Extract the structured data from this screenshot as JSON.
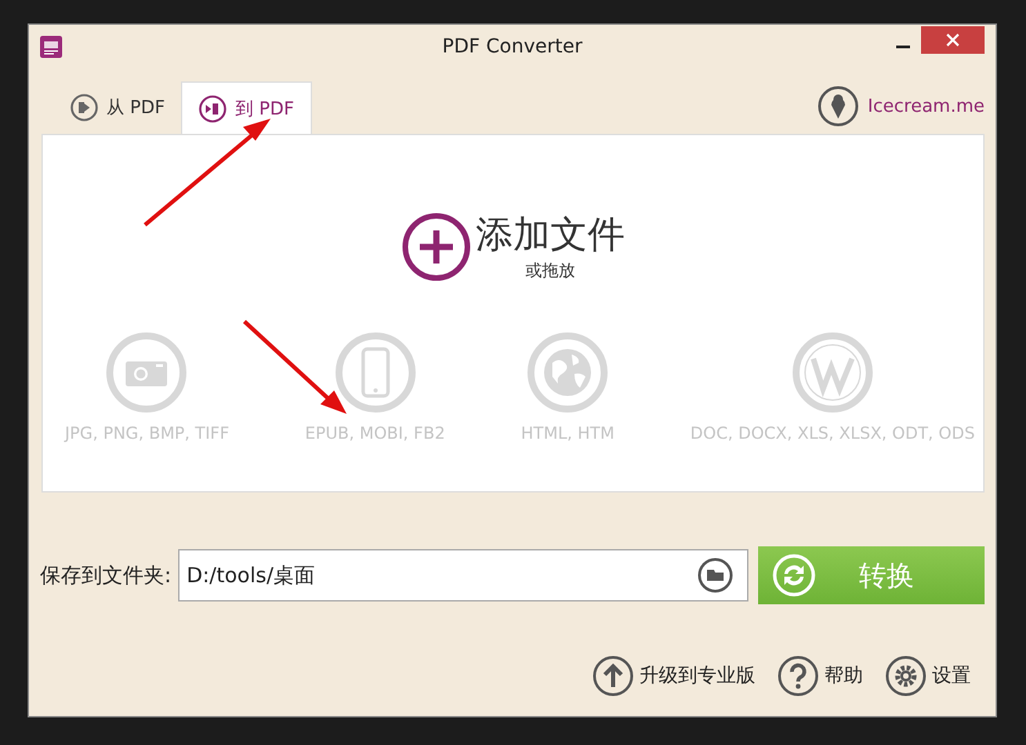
{
  "window": {
    "title": "PDF Converter"
  },
  "tabs": [
    {
      "label": "从 PDF",
      "kind": "from",
      "selected": false
    },
    {
      "label": "到 PDF",
      "kind": "to",
      "selected": true
    }
  ],
  "site_link": "Icecream.me",
  "add_files": {
    "title": "添加文件",
    "subtitle": "或拖放"
  },
  "formats": [
    {
      "kind": "image",
      "label": "JPG, PNG, BMP, TIFF"
    },
    {
      "kind": "ebook",
      "label": "EPUB, MOBI, FB2"
    },
    {
      "kind": "web",
      "label": "HTML, HTM"
    },
    {
      "kind": "office",
      "label": "DOC, DOCX, XLS, XLSX, ODT, ODS"
    }
  ],
  "save": {
    "label": "保存到文件夹:",
    "value": "D:/tools/桌面"
  },
  "convert_button": "转换",
  "footer_links": [
    {
      "kind": "upgrade",
      "label": "升级到专业版"
    },
    {
      "kind": "help",
      "label": "帮助"
    },
    {
      "kind": "settings",
      "label": "设置"
    }
  ]
}
